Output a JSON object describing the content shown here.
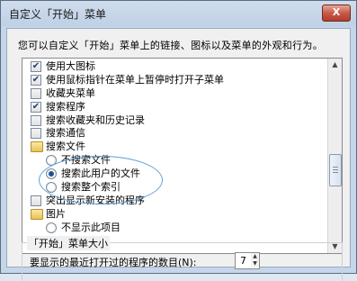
{
  "window": {
    "title": "自定义「开始」菜单",
    "close_glyph": "X"
  },
  "description": "您可以自定义「开始」菜单上的链接、图标以及菜单的外观和行为。",
  "options": [
    {
      "type": "checkbox",
      "checked": true,
      "indent": 0,
      "label": "使用大图标"
    },
    {
      "type": "checkbox",
      "checked": true,
      "indent": 0,
      "label": "使用鼠标指针在菜单上暂停时打开子菜单"
    },
    {
      "type": "checkbox",
      "checked": false,
      "indent": 0,
      "label": "收藏夹菜单"
    },
    {
      "type": "checkbox",
      "checked": true,
      "indent": 0,
      "label": "搜索程序"
    },
    {
      "type": "checkbox",
      "checked": false,
      "indent": 0,
      "label": "搜索收藏夹和历史记录"
    },
    {
      "type": "checkbox",
      "checked": false,
      "indent": 0,
      "label": "搜索通信"
    },
    {
      "type": "folder",
      "checked": false,
      "indent": 0,
      "label": "搜索文件"
    },
    {
      "type": "radio",
      "checked": false,
      "indent": 1,
      "label": "不搜索文件"
    },
    {
      "type": "radio",
      "checked": true,
      "indent": 1,
      "label": "搜索此用户的文件"
    },
    {
      "type": "radio",
      "checked": false,
      "indent": 1,
      "label": "搜索整个索引"
    },
    {
      "type": "checkbox",
      "checked": false,
      "indent": 0,
      "label": "突出显示新安装的程序"
    },
    {
      "type": "folder",
      "checked": false,
      "indent": 0,
      "label": "图片"
    },
    {
      "type": "radio",
      "checked": false,
      "indent": 1,
      "label": "不显示此项目"
    }
  ],
  "check_glyph": "✔",
  "start_menu_size": {
    "legend": "「开始」菜单大小",
    "recent_programs_label": "要显示的最近打开过的程序的数目(N):",
    "recent_programs_value": "7"
  },
  "colors": {
    "annotation_circle": "#5aa0d8",
    "close_button": "#c75a48"
  }
}
